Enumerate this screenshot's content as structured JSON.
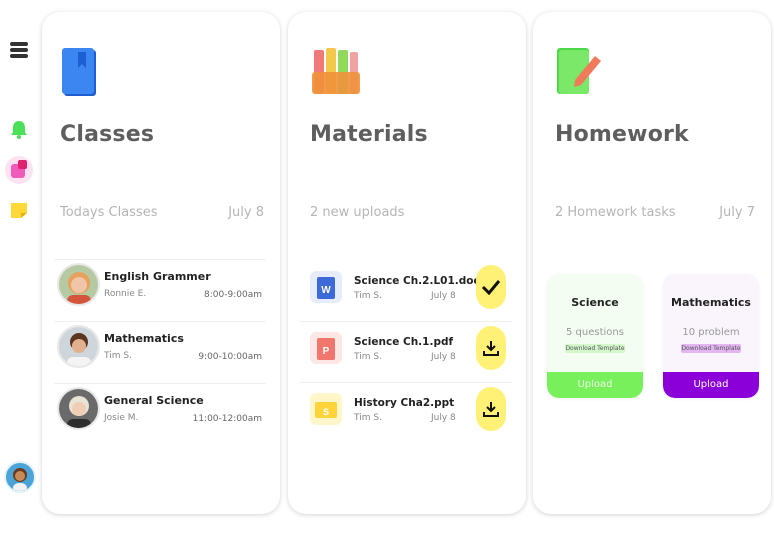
{
  "classes": {
    "title": "Classes",
    "subtitle": "Todays Classes",
    "date": "July 8",
    "items": [
      {
        "name": "English Grammer",
        "teacher": "Ronnie E.",
        "time": "8:00-9:00am"
      },
      {
        "name": "Mathematics",
        "teacher": "Tim S.",
        "time": "9:00-10:00am"
      },
      {
        "name": "General Science",
        "teacher": "Josie M.",
        "time": "11:00-12:00am"
      }
    ]
  },
  "materials": {
    "title": "Materials",
    "subtitle": "2 new uploads",
    "items": [
      {
        "file": "Science Ch.2.L01.doc",
        "by": "Tim S.",
        "date": "July 8",
        "icon": "word-doc-icon",
        "action": "checkmark-icon"
      },
      {
        "file": "Science Ch.1.pdf",
        "by": "Tim S.",
        "date": "July 8",
        "icon": "pdf-icon",
        "action": "download-icon"
      },
      {
        "file": "History Cha2.ppt",
        "by": "Tim S.",
        "date": "July 8",
        "icon": "slides-icon",
        "action": "download-icon"
      }
    ]
  },
  "homework": {
    "title": "Homework",
    "subtitle": "2 Homework tasks",
    "date": "July 7",
    "tasks": [
      {
        "subject": "Science",
        "count": "5 questions",
        "template": "Download Template",
        "upload": "Upload",
        "accent": "#78f05b"
      },
      {
        "subject": "Mathematics",
        "count": "10 problem",
        "template": "Download Template",
        "upload": "Upload",
        "accent": "#8b00d9"
      }
    ]
  },
  "sidebar": {
    "icons": [
      "menu-icon",
      "bell-icon",
      "notes-icon",
      "sticky-note-icon",
      "avatar"
    ]
  }
}
